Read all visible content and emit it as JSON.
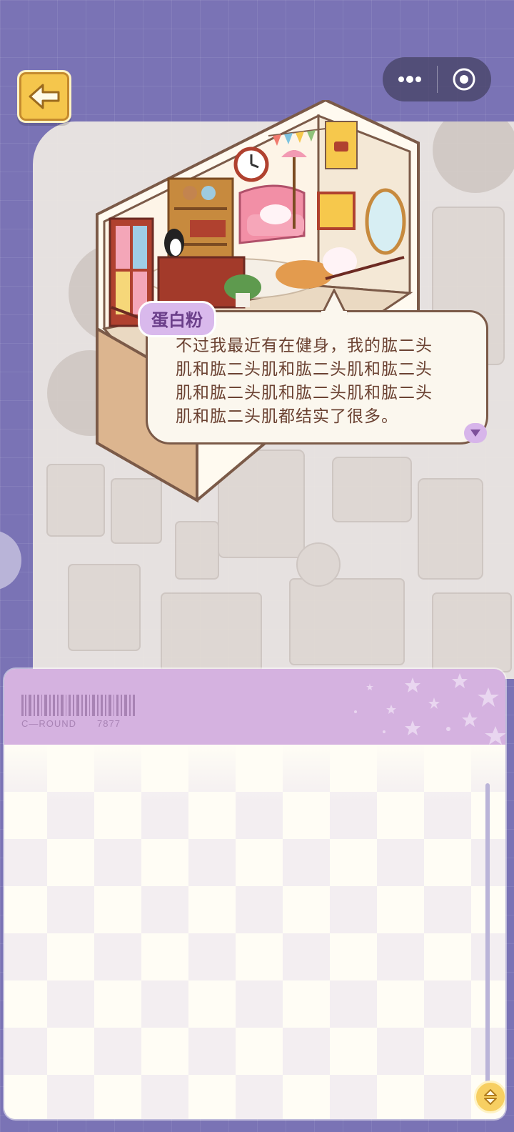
{
  "header": {
    "back_icon": "arrow-left-icon",
    "capsule": {
      "more_icon": "more-dots-icon",
      "close_icon": "target-circle-icon"
    }
  },
  "dialog": {
    "speaker": "蛋白粉",
    "lines": [
      "不过我最近有在健身，我的肱二头",
      "肌和肱二头肌和肱二头肌和肱二头",
      "肌和肱二头肌和肱二头肌和肱二头",
      "肌和肱二头肌都结实了很多。"
    ],
    "next_icon": "triangle-down-icon"
  },
  "panel": {
    "code_label": "C—ROUND",
    "code_number": "7877",
    "scroll_icon": "up-down-arrows-icon"
  },
  "colors": {
    "background": "#7a73b5",
    "panel_header": "#d5b2e0",
    "accent_yellow": "#f5c64c",
    "dialog_text": "#6b4232"
  }
}
